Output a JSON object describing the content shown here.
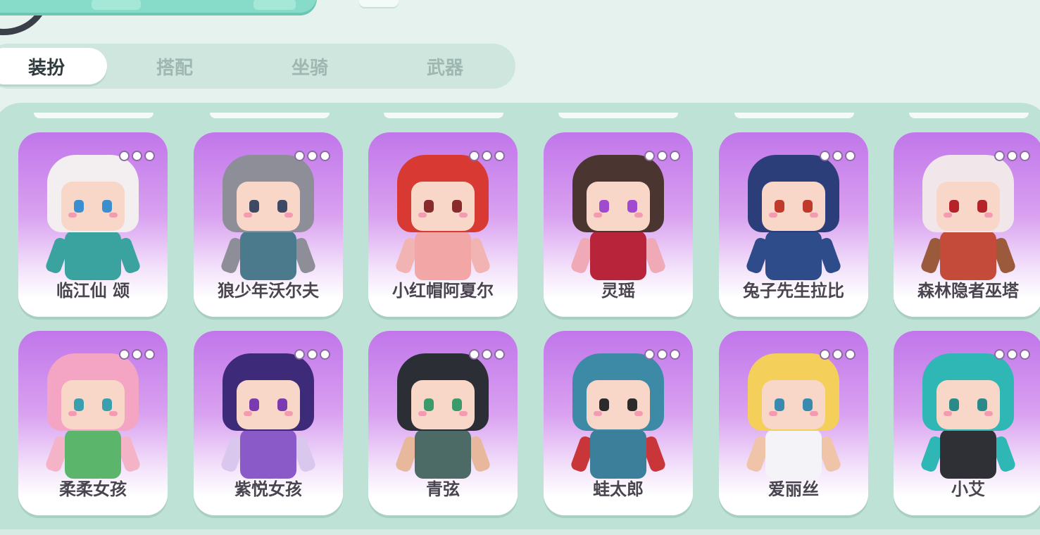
{
  "tabs": [
    {
      "label": "装扮",
      "active": true
    },
    {
      "label": "搭配",
      "active": false
    },
    {
      "label": "坐骑",
      "active": false
    },
    {
      "label": "武器",
      "active": false
    }
  ],
  "characters": [
    {
      "name": "临江仙 颂",
      "hair": "#f3eef0",
      "body": "#3aa3a0",
      "arm": "#3aa3a0",
      "eye": "#3a8fd1"
    },
    {
      "name": "狼少年沃尔夫",
      "hair": "#8d8e97",
      "body": "#4a7a8c",
      "arm": "#8d8e97",
      "eye": "#3e4a63"
    },
    {
      "name": "小红帽阿夏尔",
      "hair": "#d83a33",
      "body": "#f2a6a6",
      "arm": "#f2b3b3",
      "eye": "#8a2b2b"
    },
    {
      "name": "灵瑶",
      "hair": "#4a3530",
      "body": "#b8243a",
      "arm": "#f0a9b6",
      "eye": "#a04ad0"
    },
    {
      "name": "兔子先生拉比",
      "hair": "#2b3e7a",
      "body": "#2f4c8a",
      "arm": "#2f4c8a",
      "eye": "#c0392b"
    },
    {
      "name": "森林隐者巫塔",
      "hair": "#f1e6ea",
      "body": "#c44a3a",
      "arm": "#9b5a3c",
      "eye": "#b5232a"
    },
    {
      "name": "柔柔女孩",
      "hair": "#f4a5c3",
      "body": "#5bb56a",
      "arm": "#f4b3c6",
      "eye": "#3aa0b0"
    },
    {
      "name": "紫悦女孩",
      "hair": "#3d2a78",
      "body": "#8a5bc8",
      "arm": "#d9c7ee",
      "eye": "#7a3ab0"
    },
    {
      "name": "青弦",
      "hair": "#2b2f35",
      "body": "#4d6b66",
      "arm": "#e8b89c",
      "eye": "#3a9a6a"
    },
    {
      "name": "蛙太郎",
      "hair": "#3d8aa6",
      "body": "#3b7f9a",
      "arm": "#c9363a",
      "eye": "#2b2b2b"
    },
    {
      "name": "爱丽丝",
      "hair": "#f4cf5a",
      "body": "#f3f3f8",
      "arm": "#f0c4a8",
      "eye": "#3a8ab0"
    },
    {
      "name": "小艾",
      "hair": "#2fb7b5",
      "body": "#2f3035",
      "arm": "#2fb7b5",
      "eye": "#2a8a8a"
    }
  ]
}
